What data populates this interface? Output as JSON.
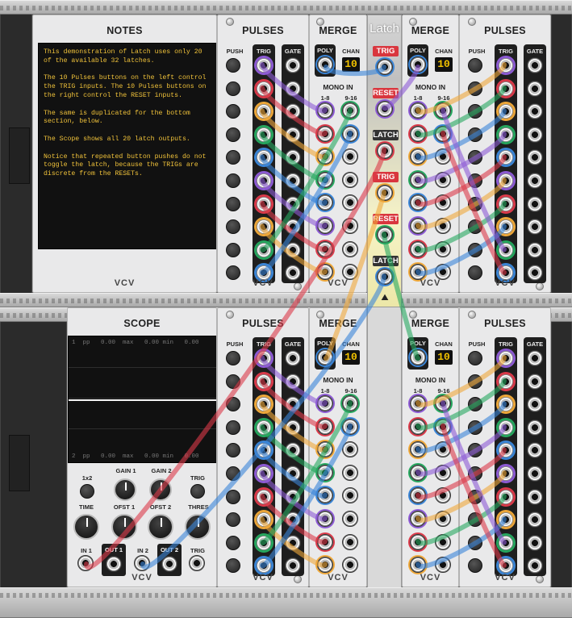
{
  "notes": {
    "title": "NOTES",
    "text": "This demonstration of Latch uses only 20\nof the available 32 latches.\n\nThe 10 Pulses buttons on the left control\nthe TRIG inputs. The 10 Pulses buttons on\nthe right control the RESET inputs.\n\nThe same is duplicated for the bottom\nsection, below.\n\nThe Scope shows all 20 latch outputs.\n\nNotice that repeated button pushes do not\ntoggle the latch, because the TRIGs are\ndiscrete from the RESETs.",
    "brand": "VCV"
  },
  "pulses": {
    "title": "PULSES",
    "push_label": "PUSH",
    "trig_label": "TRIG",
    "gate_label": "GATE",
    "brand": "VCV"
  },
  "merge": {
    "title": "MERGE",
    "poly_label": "POLY",
    "chan_label": "CHAN",
    "chan_value": "10",
    "mono_in_label": "MONO IN",
    "range1_label": "1-8",
    "range2_label": "9-16",
    "brand": "VCV"
  },
  "latch": {
    "title": "Latch",
    "labels": [
      "TRIG",
      "RESET",
      "LATCH",
      "TRIG",
      "RESET",
      "LATCH"
    ],
    "colors": [
      "#d9363e",
      "#d9363e",
      "#333333",
      "#d9363e",
      "#d9363e",
      "#333333"
    ]
  },
  "scope": {
    "title": "SCOPE",
    "row1": "1  pp   0.00  max   0.00 min   0.00",
    "row2": "2  pp   0.00  max   0.00 min   0.00",
    "btn_1x2": "1x2",
    "gain1": "GAIN 1",
    "gain2": "GAIN 2",
    "trig": "TRIG",
    "time": "TIME",
    "ofst1": "OFST 1",
    "ofst2": "OFST 2",
    "thres": "THRES",
    "in1": "IN 1",
    "out1": "OUT 1",
    "in2": "IN 2",
    "out2": "OUT 2",
    "trig_in": "TRIG",
    "brand": "VCV"
  },
  "cable_colors": [
    "#8e5bd6",
    "#dc3a4a",
    "#f0a93a",
    "#26a85f",
    "#3b86d8"
  ]
}
